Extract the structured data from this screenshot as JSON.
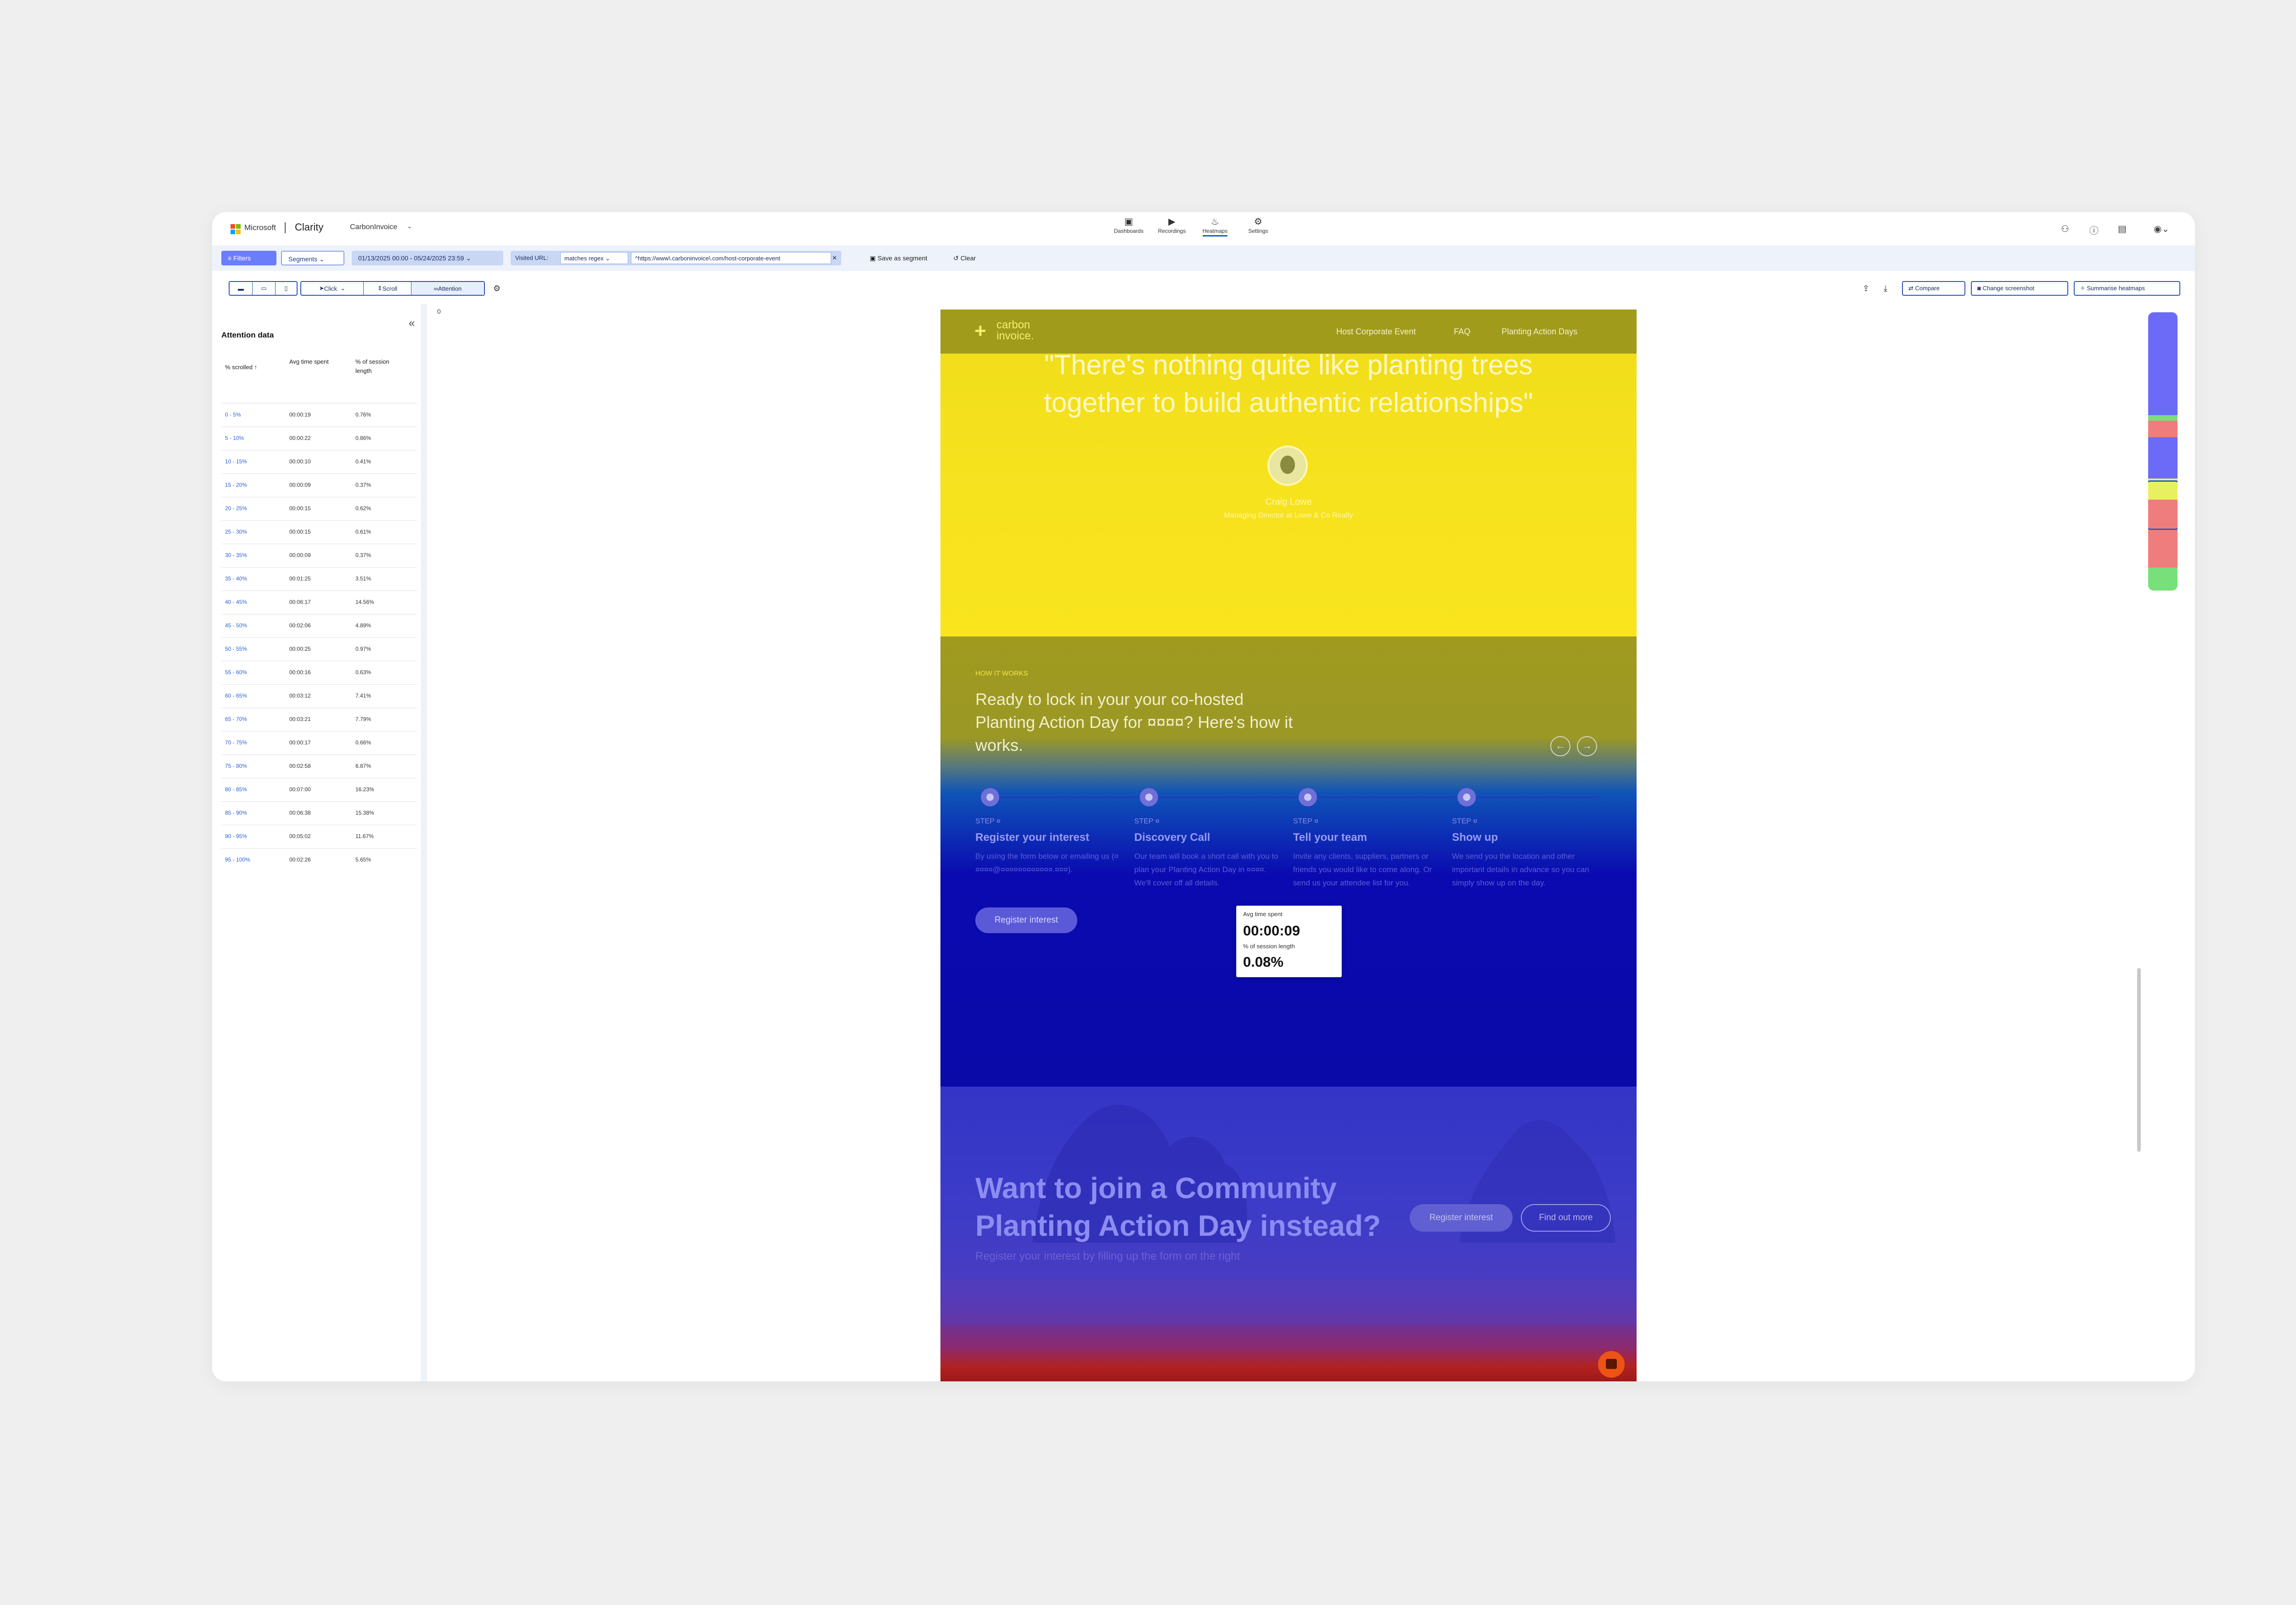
{
  "app": {
    "brand": "Microsoft",
    "product": "Clarity",
    "project": "CarbonInvoice"
  },
  "nav": {
    "items": [
      {
        "label": "Dashboards",
        "icon": "dashboard-icon"
      },
      {
        "label": "Recordings",
        "icon": "video-camera-icon"
      },
      {
        "label": "Heatmaps",
        "icon": "flame-icon",
        "active": true
      },
      {
        "label": "Settings",
        "icon": "gear-icon"
      }
    ]
  },
  "filterbar": {
    "filters_label": "Filters",
    "segments_label": "Segments",
    "date_range": "01/13/2025 00:00 - 05/24/2025 23:59",
    "visited_url_label": "Visited URL:",
    "match_type": "matches regex",
    "url_value": "^https://www\\.carboninvoice\\.com/host-corporate-event",
    "save_segment_label": "Save as segment",
    "clear_label": "Clear"
  },
  "toolbar": {
    "click_label": "Click",
    "scroll_label": "Scroll",
    "attention_label": "Attention",
    "compare_label": "Compare",
    "change_screenshot_label": "Change screenshot",
    "summarise_label": "Summarise heatmaps"
  },
  "attention": {
    "title": "Attention data",
    "columns": [
      "% scrolled",
      "Avg time spent",
      "% of session length"
    ],
    "rows": [
      [
        "0 - 5%",
        "00:00:19",
        "0.76%"
      ],
      [
        "5 - 10%",
        "00:00:22",
        "0.86%"
      ],
      [
        "10 - 15%",
        "00:00:10",
        "0.41%"
      ],
      [
        "15 - 20%",
        "00:00:09",
        "0.37%"
      ],
      [
        "20 - 25%",
        "00:00:15",
        "0.62%"
      ],
      [
        "25 - 30%",
        "00:00:15",
        "0.61%"
      ],
      [
        "30 - 35%",
        "00:00:09",
        "0.37%"
      ],
      [
        "35 - 40%",
        "00:01:25",
        "3.51%"
      ],
      [
        "40 - 45%",
        "00:06:17",
        "14.56%"
      ],
      [
        "45 - 50%",
        "00:02:06",
        "4.89%"
      ],
      [
        "50 - 55%",
        "00:00:25",
        "0.97%"
      ],
      [
        "55 - 60%",
        "00:00:16",
        "0.63%"
      ],
      [
        "60 - 65%",
        "00:03:12",
        "7.41%"
      ],
      [
        "65 - 70%",
        "00:03:21",
        "7.79%"
      ],
      [
        "70 - 75%",
        "00:00:17",
        "0.66%"
      ],
      [
        "75 - 80%",
        "00:02:58",
        "6.87%"
      ],
      [
        "80 - 85%",
        "00:07:00",
        "16.23%"
      ],
      [
        "85 - 90%",
        "00:06:38",
        "15.38%"
      ],
      [
        "90 - 95%",
        "00:05:02",
        "11.67%"
      ],
      [
        "95 - 100%",
        "00:02:26",
        "5.65%"
      ]
    ]
  },
  "canvas": {
    "offset_label": "0"
  },
  "site": {
    "logo_line1": "carbon",
    "logo_line2": "invoice.",
    "links": [
      "Host Corporate Event",
      "FAQ",
      "Planting Action Days"
    ],
    "quote_line1": "\"There's nothing quite like planting trees",
    "quote_line2": "together to build authentic relationships\"",
    "person_name": "Craig Lowe",
    "person_role": "Managing Director at Lowe & Co Realty",
    "how_eyebrow": "HOW IT WORKS",
    "how_title": "Ready to lock in your your co-hosted Planting Action Day for ¤¤¤¤? Here's how it works.",
    "steps": [
      {
        "label": "STEP ¤",
        "title": "Register your interest",
        "desc": "By using the form below or emailing us (¤¤¤¤¤@¤¤¤¤¤¤¤¤¤¤¤¤.¤¤¤)."
      },
      {
        "label": "STEP ¤",
        "title": "Discovery Call",
        "desc": "Our team will book a short call with you to plan your Planting Action Day in ¤¤¤¤. We'll cover off all details."
      },
      {
        "label": "STEP ¤",
        "title": "Tell your team",
        "desc": "Invite any clients, suppliers, partners or friends you would like to come along. Or send us your attendee list for you."
      },
      {
        "label": "STEP ¤",
        "title": "Show up",
        "desc": "We send you the location and other important details in advance so you can simply show up on the day."
      }
    ],
    "register_btn": "Register interest",
    "community_title": "Want to join a Community Planting Action Day instead?",
    "community_sub": "Register your interest by filling up the form on the right",
    "community_register": "Register interest",
    "community_find": "Find out more"
  },
  "tooltip": {
    "avg_label": "Avg time spent",
    "avg_value": "00:00:09",
    "session_label": "% of session length",
    "session_value": "0.08%"
  },
  "minimap_colors": [
    "#6b6bf8",
    "#77e07a",
    "#f07d7d",
    "#6b6bf8",
    "#e8f060",
    "#f07d7d",
    "#77e07a"
  ]
}
